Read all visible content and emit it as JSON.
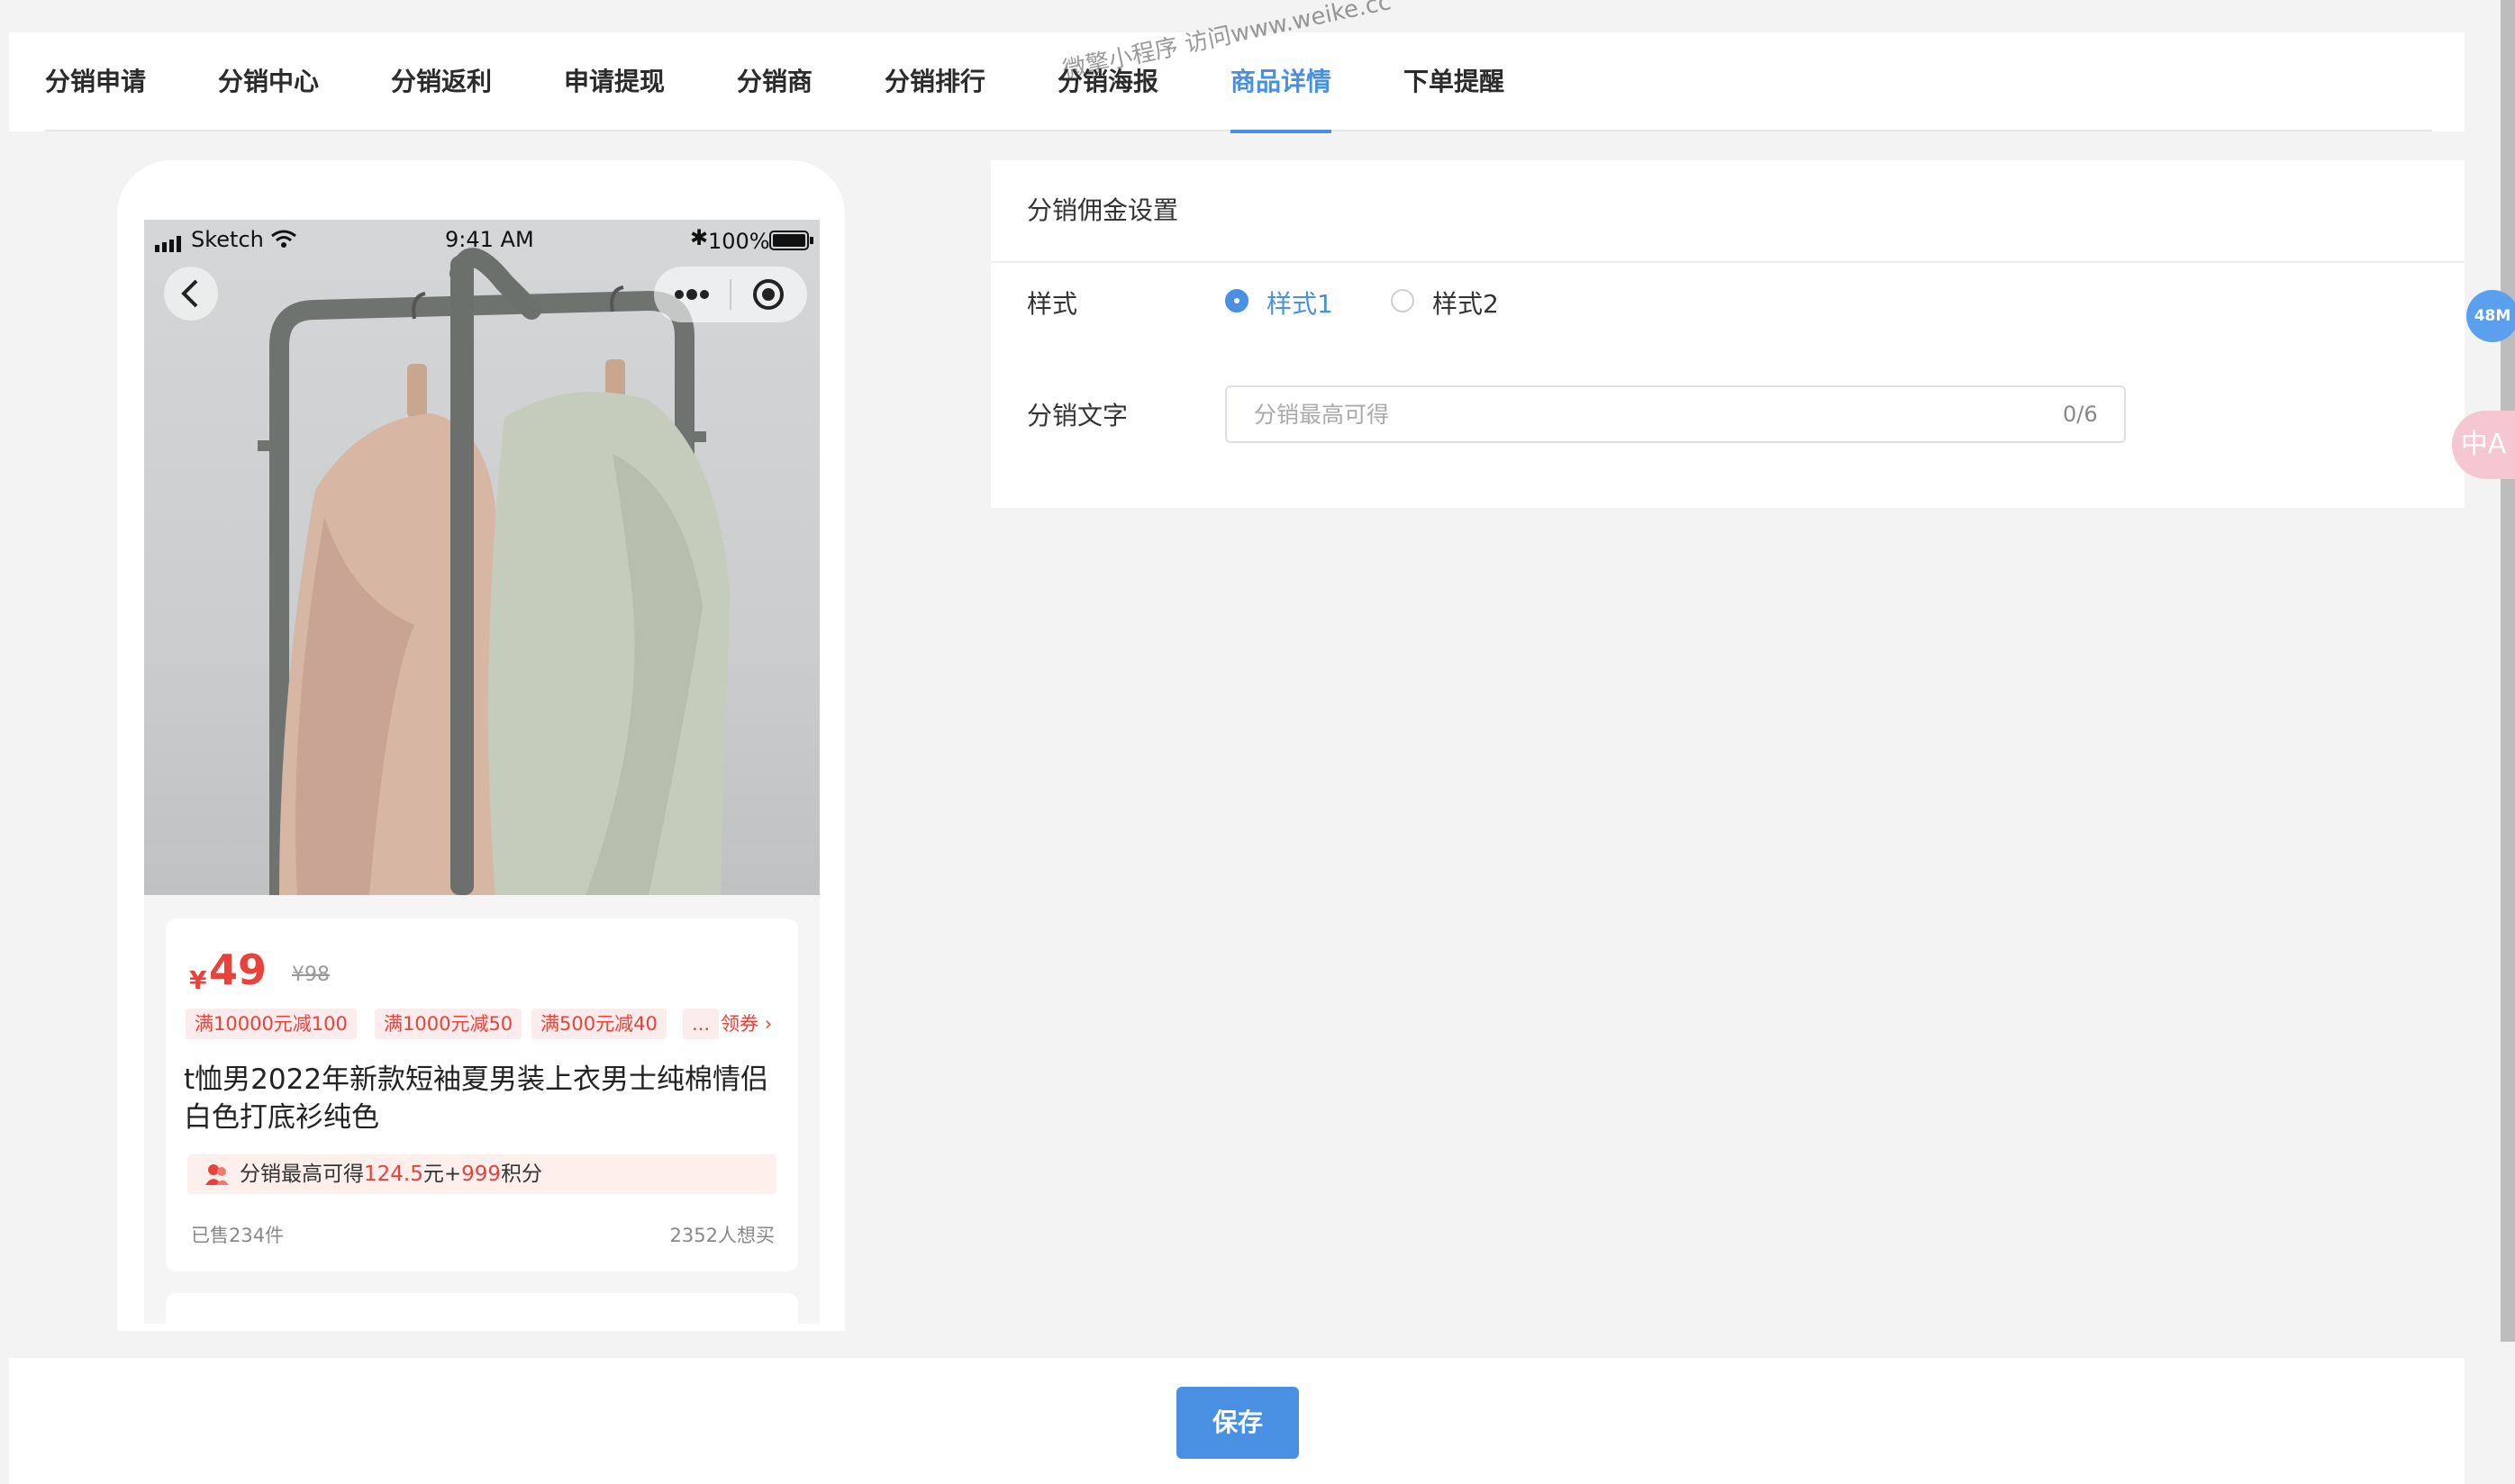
{
  "tabs": [
    {
      "label": "分销申请"
    },
    {
      "label": "分销中心"
    },
    {
      "label": "分销返利"
    },
    {
      "label": "申请提现"
    },
    {
      "label": "分销商"
    },
    {
      "label": "分销排行"
    },
    {
      "label": "分销海报"
    },
    {
      "label": "商品详情"
    },
    {
      "label": "下单提醒"
    }
  ],
  "active_tab": "商品详情",
  "watermark": "微擎小程序  访问www.weike.cc",
  "phone": {
    "status": {
      "carrier": "Sketch",
      "time": "9:41 AM",
      "battery": "100%"
    },
    "product": {
      "currency": "¥",
      "price": "49",
      "original_price": "¥98",
      "coupons": [
        "满10000元减100",
        "满1000元减50",
        "满500元减40",
        "..."
      ],
      "get_coupon": "领券",
      "title": "t恤男2022年新款短袖夏男装上衣男士纯棉情侣白色打底衫纯色",
      "distribution": {
        "prefix": "分销最高可得",
        "amount": "124.5",
        "unit": "元+",
        "points": "999",
        "points_unit": "积分"
      },
      "sold": "已售234件",
      "want": "2352人想买"
    }
  },
  "panel": {
    "title": "分销佣金设置",
    "style_label": "样式",
    "style_options": [
      "样式1",
      "样式2"
    ],
    "style_selected": "样式1",
    "text_label": "分销文字",
    "text_value": "",
    "text_placeholder": "分销最高可得",
    "text_counter": "0/6"
  },
  "save_label": "保存",
  "memory_badge": "48M",
  "translate_icon_text": "中A",
  "colors": {
    "accent": "#4a90e2",
    "price_red": "#e8423b",
    "coupon_bg": "#fdecec",
    "page_bg": "#f3f3f3"
  }
}
